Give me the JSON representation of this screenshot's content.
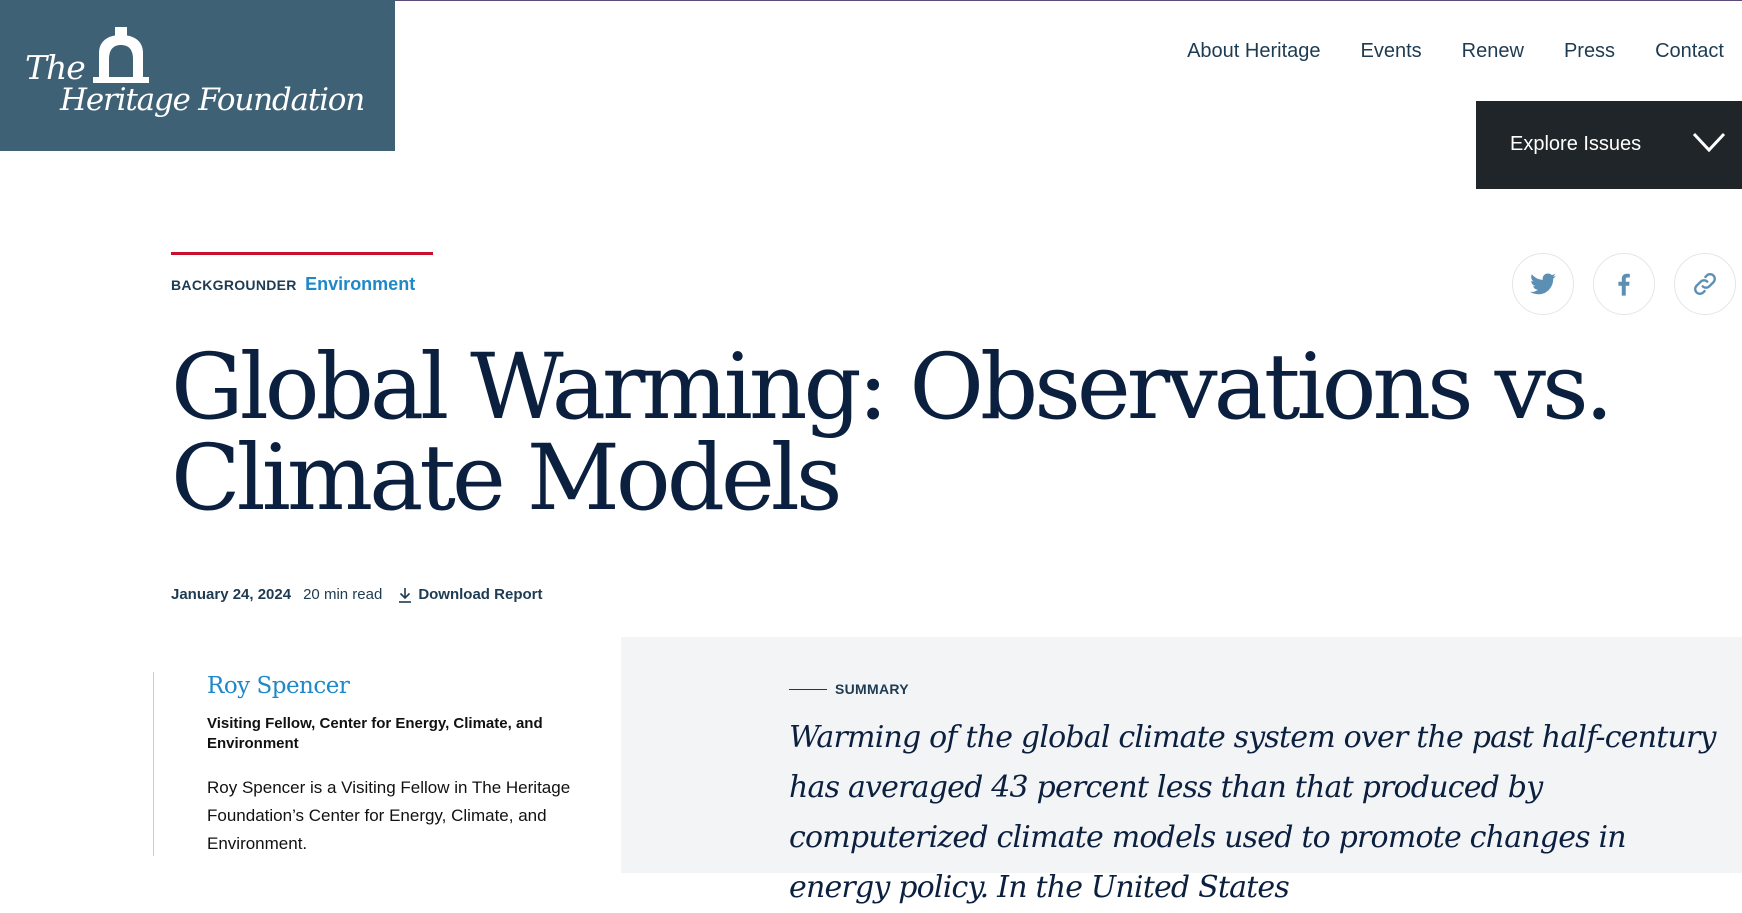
{
  "logo": {
    "line1": "The",
    "line2": "Heritage Foundation"
  },
  "nav": [
    "About Heritage",
    "Events",
    "Renew",
    "Press",
    "Contact"
  ],
  "explore": {
    "label": "Explore Issues"
  },
  "article": {
    "type": "BACKGROUNDER",
    "category": "Environment",
    "title": "Global Warming: Observations vs. Climate Models",
    "date": "January 24, 2024",
    "read_time": "20 min read",
    "download_label": "Download Report"
  },
  "share": {
    "icons": [
      "twitter-icon",
      "facebook-icon",
      "link-icon"
    ]
  },
  "author": {
    "name": "Roy Spencer",
    "role": "Visiting Fellow, Center for Energy, Climate, and Environment",
    "bio": "Roy Spencer is a Visiting Fellow in The Heritage Foundation’s Center for Energy, Climate, and Environment."
  },
  "summary": {
    "label": "SUMMARY",
    "text": "Warming of the global climate system over the past half-century has averaged 43 percent less than that produced by computerized climate models used to promote changes in energy policy. In the United States"
  },
  "colors": {
    "logo_bg": "#3e6175",
    "explore_bg": "#1f2529",
    "accent_red": "#c8102e",
    "link_blue": "#1e88c9",
    "navy_text": "#0b1f3f",
    "summary_bg": "#f3f4f6"
  }
}
